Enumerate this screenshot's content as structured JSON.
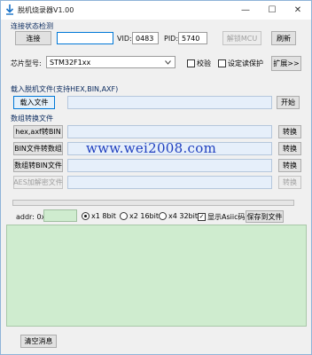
{
  "window": {
    "title": "脱机烧录器V1.00",
    "minimize_glyph": "—",
    "maximize_glyph": "☐",
    "close_glyph": "✕"
  },
  "connection": {
    "section_label": "连接状态检测",
    "connect_label": "连接",
    "port_value": "",
    "vid_label": "VID:",
    "vid_value": "0483",
    "pid_label": "PID:",
    "pid_value": "5740",
    "unlock_label": "解锁MCU",
    "refresh_label": "刷新"
  },
  "chip": {
    "label": "芯片型号:",
    "selected": "STM32F1xx",
    "verify_label": "校验",
    "readprotect_label": "设定读保护",
    "expand_label": "扩展>>"
  },
  "load": {
    "section_label": "载入脱机文件(支持HEX,BIN,AXF)",
    "load_label": "载入文件",
    "path_value": "",
    "start_label": "开始"
  },
  "convert": {
    "section_label": "数组转换文件",
    "rows": [
      {
        "button": "hex,axf转BIN",
        "value": "",
        "action": "转换",
        "disabled": false
      },
      {
        "button": "BIN文件转数组",
        "value": "",
        "action": "转换",
        "disabled": false
      },
      {
        "button": "数组转BIN文件",
        "value": "",
        "action": "转换",
        "disabled": false
      },
      {
        "button": "AES加解密文件",
        "value": "",
        "action": "转换",
        "disabled": true
      }
    ]
  },
  "watermark": "www.wei2008.com",
  "output": {
    "addr_label": "addr: 0x",
    "addr_value": "",
    "radio_8": "x1 8bit",
    "radio_16": "x2 16bit",
    "radio_32": "x4 32bit",
    "show_ascii_label": "显示Asiic码",
    "save_label": "保存到文件",
    "log_text": "",
    "clear_label": "清空消息"
  },
  "colors": {
    "accent": "#0078d7",
    "log_bg": "#cfeccf",
    "field_blue": "#e6effa",
    "watermark": "#1f3fbf"
  },
  "icons": {
    "app": "download-arrow-icon",
    "dropdown": "chevron-down-icon"
  }
}
